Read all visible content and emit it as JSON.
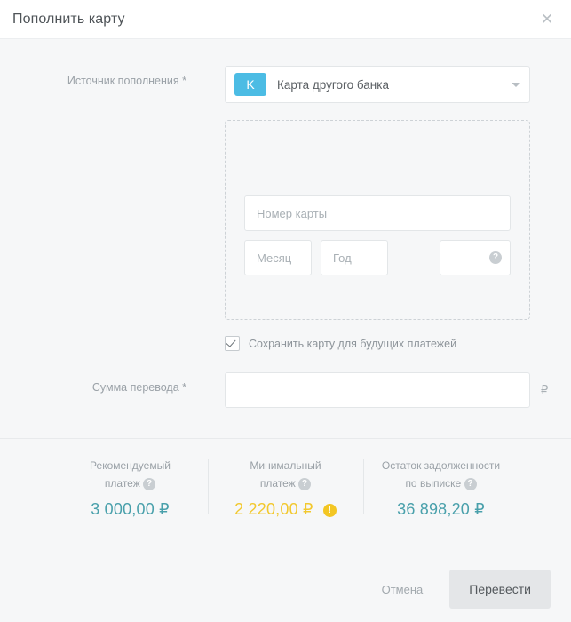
{
  "header": {
    "title": "Пополнить карту",
    "close_icon": "close-icon"
  },
  "form": {
    "source": {
      "label": "Источник пополнения *",
      "badge_letter": "K",
      "selected_option": "Карта другого банка",
      "caret_icon": "chevron-down-icon"
    },
    "card": {
      "number_placeholder": "Номер карты",
      "month_placeholder": "Месяц",
      "year_placeholder": "Год",
      "cvv_placeholder": "",
      "cvv_help_icon": "help-icon"
    },
    "save_card": {
      "label": "Сохранить карту для будущих платежей",
      "checked": true
    },
    "amount": {
      "label": "Сумма перевода *",
      "value": "",
      "placeholder": "",
      "currency": "₽"
    }
  },
  "summary": [
    {
      "label_line1": "Рекомендуемый",
      "label_line2": "платеж",
      "help_icon": "help-icon",
      "value": "3 000,00 ₽",
      "color": "#49a0ab",
      "warning": false
    },
    {
      "label_line1": "Минимальный",
      "label_line2": "платеж",
      "help_icon": "help-icon",
      "value": "2 220,00 ₽",
      "color": "#f2c82e",
      "warning": true,
      "warning_icon": "warning-icon"
    },
    {
      "label_line1": "Остаток задолженности",
      "label_line2": "по выписке",
      "help_icon": "help-icon",
      "value": "36 898,20 ₽",
      "color": "#49a0ab",
      "warning": false
    }
  ],
  "footer": {
    "cancel_label": "Отмена",
    "submit_label": "Перевести"
  },
  "colors": {
    "accent_blue": "#4cbce4",
    "teal": "#49a0ab",
    "amber": "#f2c82e",
    "background": "#f6f7f8"
  }
}
